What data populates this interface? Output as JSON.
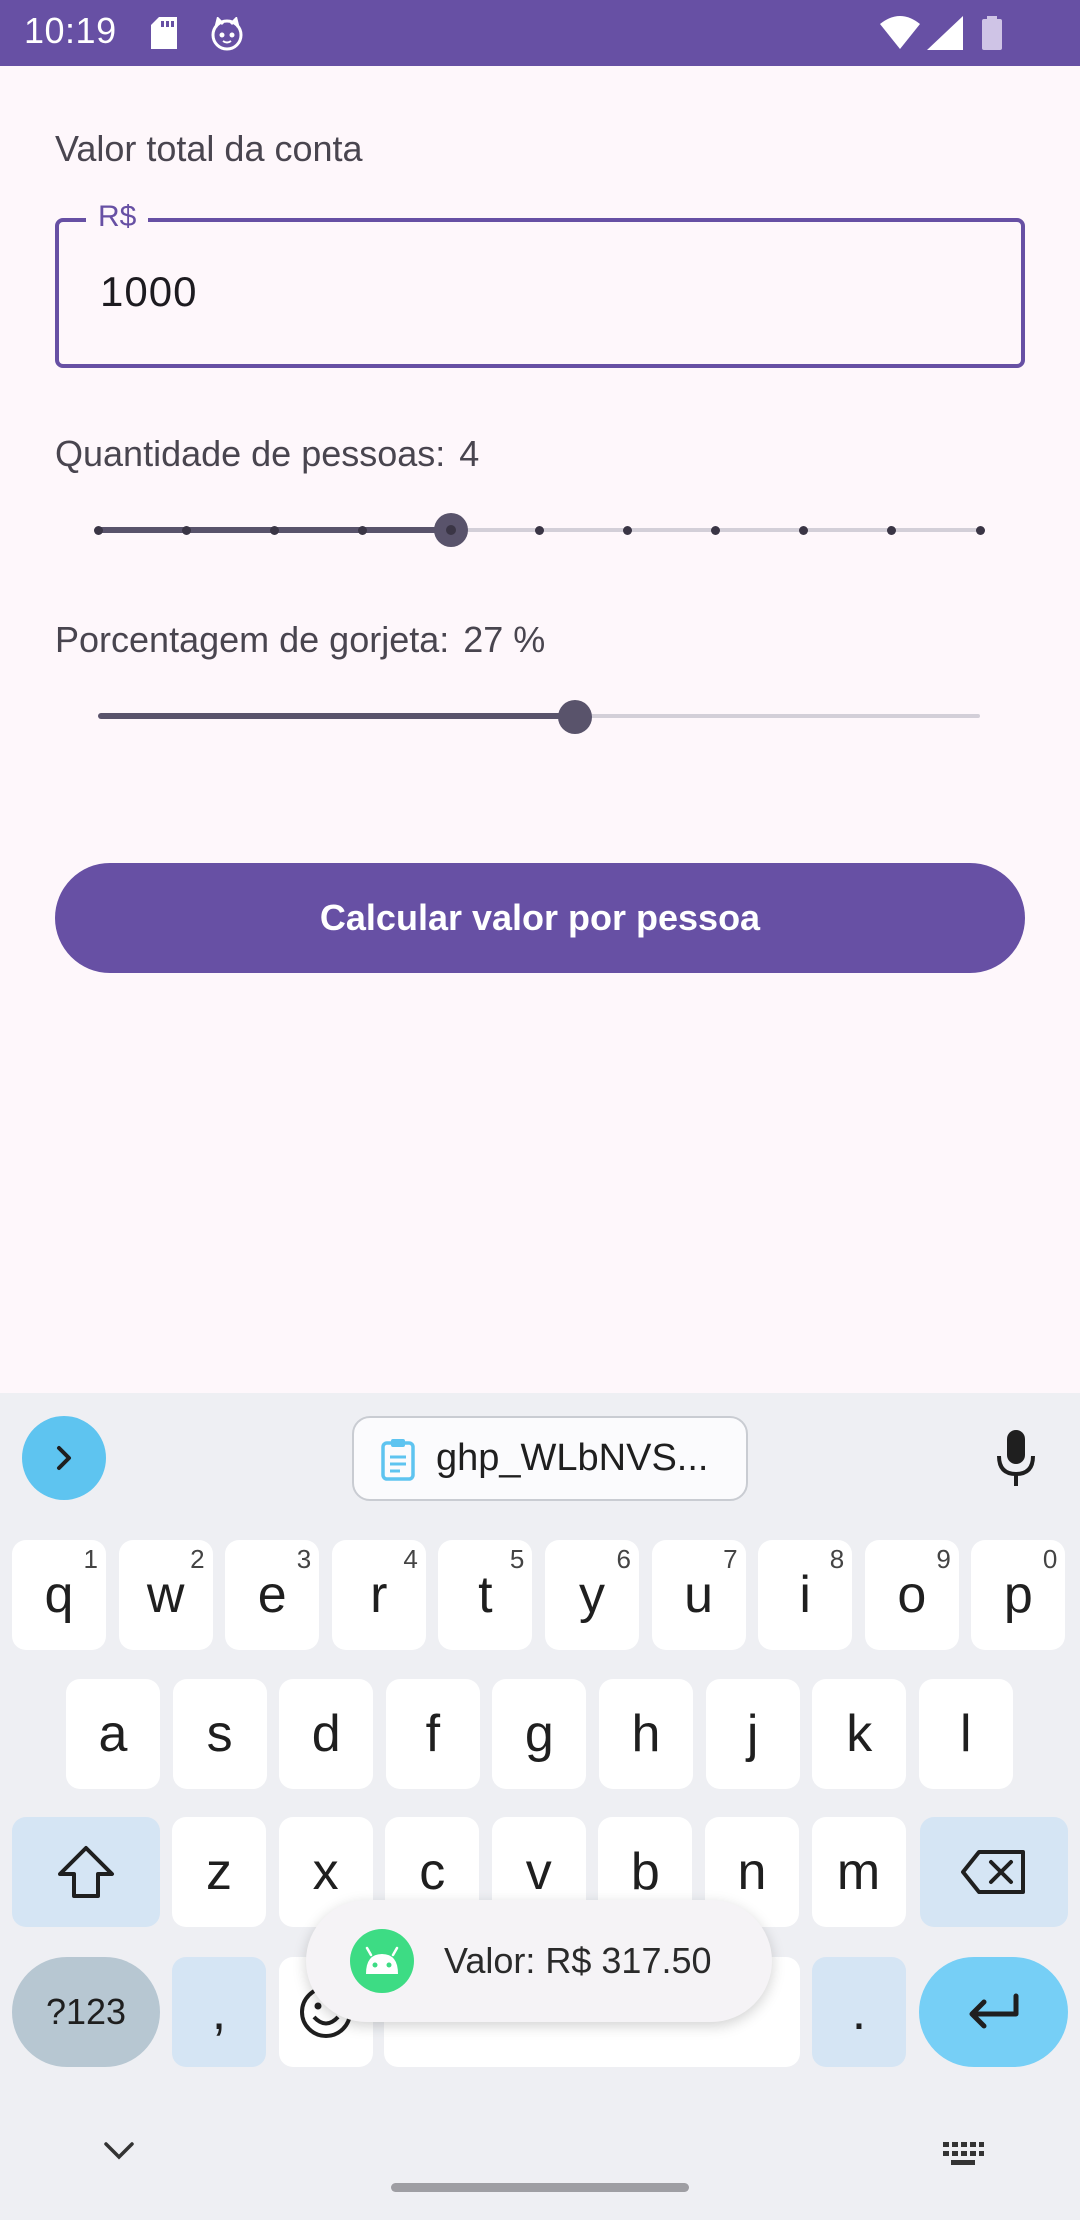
{
  "status_bar": {
    "time": "10:19",
    "icons": [
      "sd-card-icon",
      "android-cat-icon",
      "wifi-icon",
      "signal-icon",
      "battery-icon"
    ]
  },
  "bill": {
    "label": "Valor total da conta",
    "field_label": "R$",
    "value": "1000"
  },
  "people": {
    "label": "Quantidade de pessoas:",
    "value": "4",
    "slider": {
      "min": 0,
      "max": 10,
      "steps": 11,
      "current": 4
    }
  },
  "tip": {
    "label": "Porcentagem de gorjeta:",
    "value": "27 %",
    "slider": {
      "fraction": 0.54
    }
  },
  "calculate_button": {
    "label": "Calcular valor por pessoa"
  },
  "toast": {
    "message": "Valor: R$ 317.50"
  },
  "keyboard": {
    "clipboard_chip": "ghp_WLbNVS...",
    "row1": [
      {
        "k": "q",
        "h": "1"
      },
      {
        "k": "w",
        "h": "2"
      },
      {
        "k": "e",
        "h": "3"
      },
      {
        "k": "r",
        "h": "4"
      },
      {
        "k": "t",
        "h": "5"
      },
      {
        "k": "y",
        "h": "6"
      },
      {
        "k": "u",
        "h": "7"
      },
      {
        "k": "i",
        "h": "8"
      },
      {
        "k": "o",
        "h": "9"
      },
      {
        "k": "p",
        "h": "0"
      }
    ],
    "row2": [
      "a",
      "s",
      "d",
      "f",
      "g",
      "h",
      "j",
      "k",
      "l"
    ],
    "row3": [
      "z",
      "x",
      "c",
      "v",
      "b",
      "n",
      "m"
    ],
    "symbols_key": "?123",
    "comma_key": ",",
    "period_key": "."
  },
  "colors": {
    "primary": "#6750a4",
    "background": "#fef7fb",
    "toast_icon": "#3ddc84",
    "keyboard_accent": "#76cff6"
  }
}
